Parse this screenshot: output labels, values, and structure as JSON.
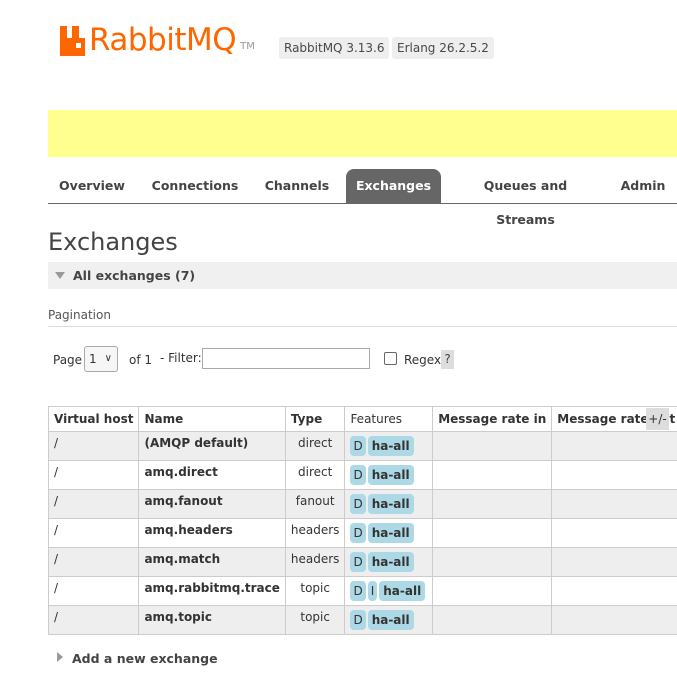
{
  "header": {
    "logo_text": "RabbitMQ",
    "logo_tm": "TM",
    "versions": [
      "RabbitMQ 3.13.6",
      "Erlang 26.2.5.2"
    ]
  },
  "tabs": [
    {
      "label": "Overview",
      "active": false
    },
    {
      "label": "Connections",
      "active": false
    },
    {
      "label": "Channels",
      "active": false
    },
    {
      "label": "Exchanges",
      "active": true
    },
    {
      "label": "Queues and Streams",
      "active": false
    },
    {
      "label": "Admin",
      "active": false
    }
  ],
  "page_title": "Exchanges",
  "section": {
    "label": "All exchanges (7)"
  },
  "pagination": {
    "title": "Pagination",
    "page_label": "Page",
    "page_value": "1",
    "of_label": "of 1",
    "filter_label": "- Filter:",
    "filter_value": "",
    "regex_label": "Regex",
    "help_label": "?"
  },
  "table": {
    "headers": [
      "Virtual host",
      "Name",
      "Type",
      "Features",
      "Message rate in",
      "Message rate out"
    ],
    "toggle_label": "+/-",
    "rows": [
      {
        "vhost": "/",
        "name": "(AMQP default)",
        "type": "direct",
        "features": [
          "D"
        ],
        "policy": "ha-all",
        "rate_in": "",
        "rate_out": ""
      },
      {
        "vhost": "/",
        "name": "amq.direct",
        "type": "direct",
        "features": [
          "D"
        ],
        "policy": "ha-all",
        "rate_in": "",
        "rate_out": ""
      },
      {
        "vhost": "/",
        "name": "amq.fanout",
        "type": "fanout",
        "features": [
          "D"
        ],
        "policy": "ha-all",
        "rate_in": "",
        "rate_out": ""
      },
      {
        "vhost": "/",
        "name": "amq.headers",
        "type": "headers",
        "features": [
          "D"
        ],
        "policy": "ha-all",
        "rate_in": "",
        "rate_out": ""
      },
      {
        "vhost": "/",
        "name": "amq.match",
        "type": "headers",
        "features": [
          "D"
        ],
        "policy": "ha-all",
        "rate_in": "",
        "rate_out": ""
      },
      {
        "vhost": "/",
        "name": "amq.rabbitmq.trace",
        "type": "topic",
        "features": [
          "D",
          "I"
        ],
        "policy": "ha-all",
        "rate_in": "",
        "rate_out": ""
      },
      {
        "vhost": "/",
        "name": "amq.topic",
        "type": "topic",
        "features": [
          "D"
        ],
        "policy": "ha-all",
        "rate_in": "",
        "rate_out": ""
      }
    ]
  },
  "add_exchange_label": "Add a new exchange",
  "colors": {
    "brand": "#ff6600",
    "banner": "#ffff8f",
    "tab_active": "#666666",
    "feature_badge": "#add8e6"
  }
}
